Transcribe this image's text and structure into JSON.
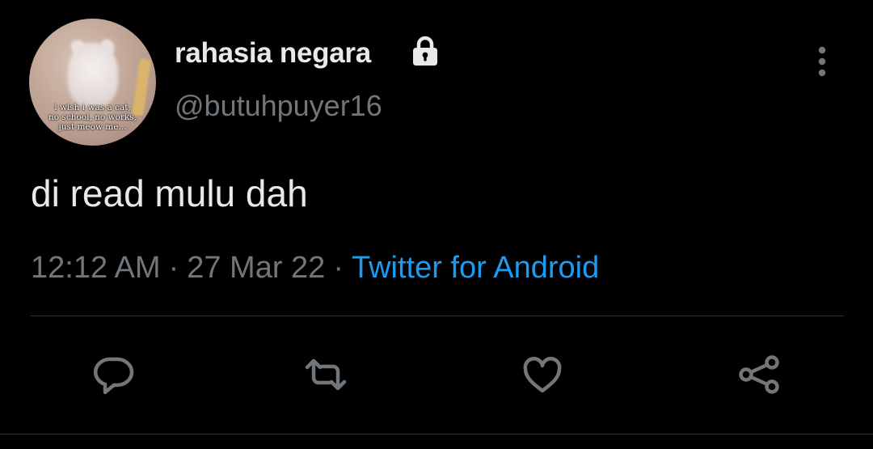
{
  "user": {
    "display_name": "rahasia negara",
    "username": "@butuhpuyer16",
    "avatar_caption": [
      "i wish i was a cat,",
      "no school, no works,",
      "just meow me..."
    ]
  },
  "tweet": {
    "text": "di read mulu dah",
    "time": "12:12 AM",
    "separator": "·",
    "date": "27 Mar 22",
    "source": "Twitter for Android"
  },
  "icons": {
    "lock": "lock-icon",
    "more": "more-vertical-icon",
    "reply": "reply-icon",
    "retweet": "retweet-icon",
    "like": "heart-icon",
    "share": "share-icon"
  },
  "colors": {
    "background": "#000000",
    "text": "#e7e9ea",
    "secondary": "#71767b",
    "link": "#1d9bf0",
    "divider": "#2f3336"
  }
}
